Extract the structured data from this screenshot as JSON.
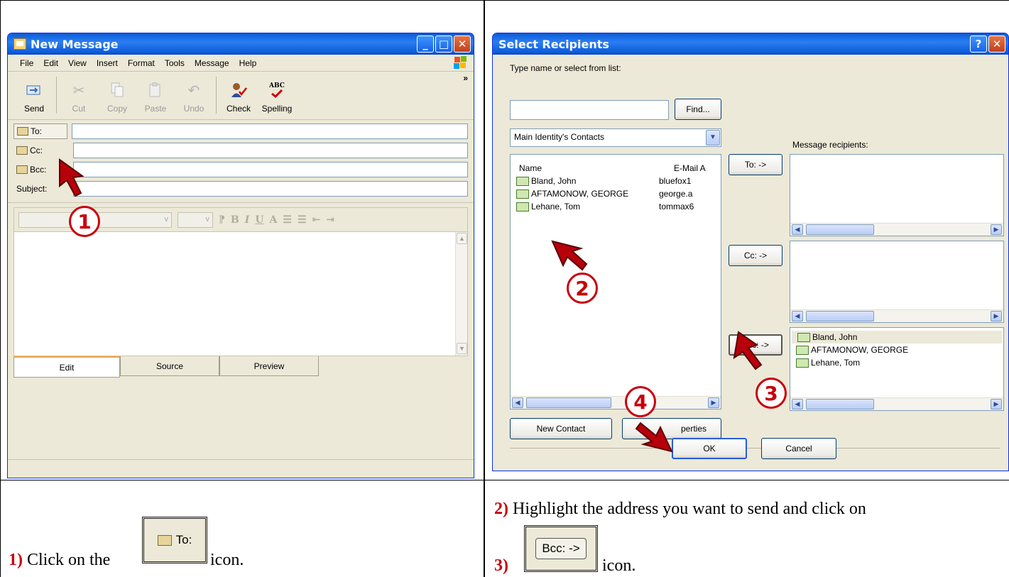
{
  "left_window": {
    "title": "New Message",
    "menu": [
      "File",
      "Edit",
      "View",
      "Insert",
      "Format",
      "Tools",
      "Message",
      "Help"
    ],
    "toolbar": [
      {
        "label": "Send",
        "icon": "send-icon",
        "enabled": true
      },
      {
        "label": "Cut",
        "icon": "cut-icon",
        "enabled": false
      },
      {
        "label": "Copy",
        "icon": "copy-icon",
        "enabled": false
      },
      {
        "label": "Paste",
        "icon": "paste-icon",
        "enabled": false
      },
      {
        "label": "Undo",
        "icon": "undo-icon",
        "enabled": false
      },
      {
        "label": "Check",
        "icon": "check-names-icon",
        "enabled": true
      },
      {
        "label": "Spelling",
        "icon": "spelling-icon",
        "enabled": true
      }
    ],
    "spelling_icon_text": "ABC",
    "more_chevron": "»",
    "address_fields": {
      "to": "To:",
      "cc": "Cc:",
      "bcc": "Bcc:",
      "subject": "Subject:"
    },
    "tabs": [
      "Edit",
      "Source",
      "Preview"
    ],
    "active_tab": "Edit"
  },
  "right_window": {
    "title": "Select Recipients",
    "help_button": "?",
    "search_label": "Type name or select from list:",
    "find_button": "Find...",
    "address_book": "Main Identity's Contacts",
    "columns": {
      "name": "Name",
      "email": "E-Mail A"
    },
    "contacts": [
      {
        "name": "Bland, John",
        "email": "bluefox1"
      },
      {
        "name": "AFTAMONOW, GEORGE",
        "email": "george.a"
      },
      {
        "name": "Lehane, Tom",
        "email": "tommax6"
      }
    ],
    "message_recipients_label": "Message recipients:",
    "to_button": "To: ->",
    "cc_button": "Cc: ->",
    "bcc_button": "Bcc: ->",
    "bcc_recipients": [
      "Bland, John",
      "AFTAMONOW, GEORGE",
      "Lehane, Tom"
    ],
    "new_contact_button": "New Contact",
    "properties_button": "perties",
    "ok_button": "OK",
    "cancel_button": "Cancel"
  },
  "callouts": [
    "1",
    "2",
    "3",
    "4"
  ],
  "captions": {
    "step1_num": "1)",
    "step1_before": "Click on the",
    "step1_btn": "To:",
    "step1_after": "icon.",
    "step2_num": "2)",
    "step2_text": "Highlight the address you want to send and click on",
    "step3_num": "3)",
    "step3_btn": "Bcc: ->",
    "step3_after": "icon."
  },
  "colors": {
    "xp_blue": "#0a5ad8",
    "callout_red": "#c8000a",
    "window_bg": "#ece9d8"
  }
}
